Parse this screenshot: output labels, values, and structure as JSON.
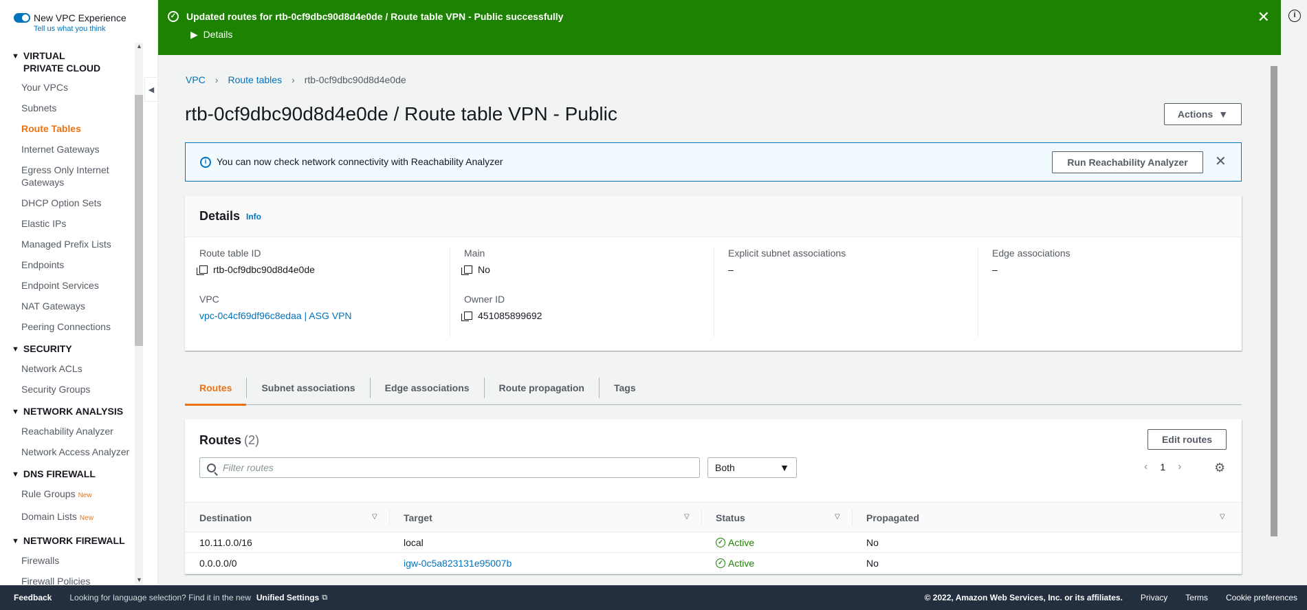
{
  "sidebar": {
    "toggle_label": "New VPC Experience",
    "feedback_link": "Tell us what you think",
    "sections": [
      {
        "title": "VIRTUAL PRIVATE CLOUD",
        "items": [
          {
            "label": "Your VPCs"
          },
          {
            "label": "Subnets"
          },
          {
            "label": "Route Tables",
            "active": true
          },
          {
            "label": "Internet Gateways"
          },
          {
            "label": "Egress Only Internet Gateways"
          },
          {
            "label": "DHCP Option Sets"
          },
          {
            "label": "Elastic IPs"
          },
          {
            "label": "Managed Prefix Lists"
          },
          {
            "label": "Endpoints"
          },
          {
            "label": "Endpoint Services"
          },
          {
            "label": "NAT Gateways"
          },
          {
            "label": "Peering Connections"
          }
        ]
      },
      {
        "title": "SECURITY",
        "items": [
          {
            "label": "Network ACLs"
          },
          {
            "label": "Security Groups"
          }
        ]
      },
      {
        "title": "NETWORK ANALYSIS",
        "items": [
          {
            "label": "Reachability Analyzer"
          },
          {
            "label": "Network Access Analyzer"
          }
        ]
      },
      {
        "title": "DNS FIREWALL",
        "items": [
          {
            "label": "Rule Groups",
            "badge": "New"
          },
          {
            "label": "Domain Lists",
            "badge": "New"
          }
        ]
      },
      {
        "title": "NETWORK FIREWALL",
        "items": [
          {
            "label": "Firewalls"
          },
          {
            "label": "Firewall Policies"
          }
        ]
      }
    ]
  },
  "flash": {
    "message": "Updated routes for rtb-0cf9dbc90d8d4e0de / Route table VPN - Public successfully",
    "details_label": "Details"
  },
  "breadcrumb": [
    "VPC",
    "Route tables",
    "rtb-0cf9dbc90d8d4e0de"
  ],
  "page_title": "rtb-0cf9dbc90d8d4e0de / Route table VPN - Public",
  "actions_label": "Actions",
  "alert": {
    "text": "You can now check network connectivity with Reachability Analyzer",
    "button": "Run Reachability Analyzer"
  },
  "details": {
    "title": "Details",
    "info": "Info",
    "route_table_id_label": "Route table ID",
    "route_table_id": "rtb-0cf9dbc90d8d4e0de",
    "vpc_label": "VPC",
    "vpc": "vpc-0c4cf69df96c8edaa | ASG VPN",
    "main_label": "Main",
    "main": "No",
    "owner_label": "Owner ID",
    "owner": "451085899692",
    "explicit_label": "Explicit subnet associations",
    "explicit": "–",
    "edge_label": "Edge associations",
    "edge": "–"
  },
  "tabs": [
    {
      "label": "Routes",
      "active": true
    },
    {
      "label": "Subnet associations"
    },
    {
      "label": "Edge associations"
    },
    {
      "label": "Route propagation"
    },
    {
      "label": "Tags"
    }
  ],
  "routes": {
    "title": "Routes",
    "count": "(2)",
    "edit_button": "Edit routes",
    "filter_placeholder": "Filter routes",
    "select_value": "Both",
    "page": "1",
    "columns": [
      "Destination",
      "Target",
      "Status",
      "Propagated"
    ],
    "rows": [
      {
        "destination": "10.11.0.0/16",
        "target": "local",
        "target_link": false,
        "status": "Active",
        "propagated": "No"
      },
      {
        "destination": "0.0.0.0/0",
        "target": "igw-0c5a823131e95007b",
        "target_link": true,
        "status": "Active",
        "propagated": "No"
      }
    ]
  },
  "footer": {
    "feedback": "Feedback",
    "lang_text": "Looking for language selection? Find it in the new",
    "unified": "Unified Settings",
    "copyright": "© 2022, Amazon Web Services, Inc. or its affiliates.",
    "privacy": "Privacy",
    "terms": "Terms",
    "cookies": "Cookie preferences"
  },
  "colors": {
    "success": "#1d8102",
    "accent": "#ec7211",
    "link": "#0073bb",
    "footer_bg": "#232f3e"
  }
}
